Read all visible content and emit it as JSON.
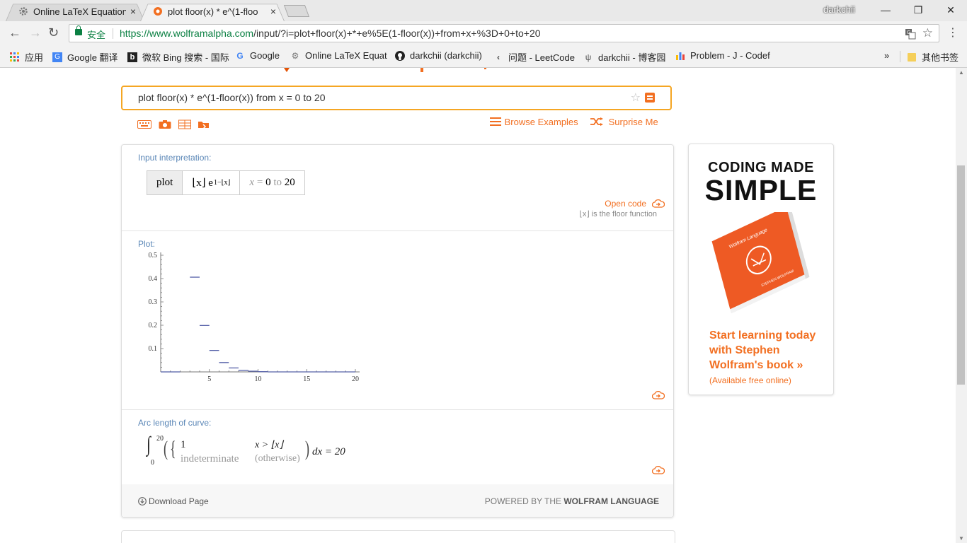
{
  "browser": {
    "tabs": [
      {
        "title": "Online LaTeX Equation",
        "close": "×",
        "active": false
      },
      {
        "title": "plot floor(x) * e^(1-floo",
        "close": "×",
        "active": true
      }
    ],
    "profile": "darkchii",
    "window_controls": {
      "minimize": "—",
      "maximize": "❐",
      "close": "✕"
    },
    "secure_label": "安全",
    "url_scheme_host": "https://www.wolframalpha.com",
    "url_path": "/input/?i=plot+floor(x)+*+e%5E(1-floor(x))+from+x+%3D+0+to+20",
    "bookmarks": [
      {
        "icon": "apps-grid-icon",
        "label": "应用"
      },
      {
        "icon": "google-translate-icon",
        "label": "Google 翻译"
      },
      {
        "icon": "bing-icon",
        "label": "微软 Bing 搜索 - 国际"
      },
      {
        "icon": "google-icon",
        "label": "Google"
      },
      {
        "icon": "gear-icon",
        "label": "Online LaTeX Equat"
      },
      {
        "icon": "github-icon",
        "label": "darkchii (darkchii)"
      },
      {
        "icon": "leetcode-icon",
        "label": "问题 - LeetCode"
      },
      {
        "icon": "cnblogs-icon",
        "label": "darkchii - 博客园"
      },
      {
        "icon": "codeforces-icon",
        "label": "Problem - J - Codef"
      }
    ],
    "bookmarks_overflow": "»",
    "other_bookmarks": "其他书签"
  },
  "search": {
    "query": "plot floor(x) * e^(1-floor(x)) from x = 0 to 20",
    "star": "☆"
  },
  "links": {
    "browse_examples": "Browse Examples",
    "surprise_me": "Surprise Me"
  },
  "pods": {
    "input_interpretation": {
      "title": "Input interpretation:",
      "cell_plot": "plot",
      "cell_func": "⌊x⌋ e",
      "cell_func_exp": "1−⌊x⌋",
      "cell_range_var": "x",
      "cell_range_eq": " = ",
      "cell_range_from": "0",
      "cell_range_to_word": " to ",
      "cell_range_to": "20",
      "open_code": "Open code",
      "note": "⌊x⌋ is the floor function"
    },
    "plot": {
      "title": "Plot:"
    },
    "arc_length": {
      "title": "Arc length of curve:",
      "lower": "0",
      "upper": "20",
      "case1_value": "1",
      "case1_cond": "x > ⌊x⌋",
      "case2_value": "indeterminate",
      "case2_cond": "(otherwise)",
      "tail": "dx = 20"
    }
  },
  "footer": {
    "download": "Download Page",
    "powered_prefix": "POWERED BY THE ",
    "powered_brand": "WOLFRAM LANGUAGE"
  },
  "ad": {
    "headline1": "CODING MADE",
    "headline2": "SIMPLE",
    "book_text": "AN ELEMENTARY INTRODUCTION TO THE Wolfram Language",
    "book_author": "STEPHEN WOLFRAM",
    "cta": "Start learning today with Stephen Wolfram's book »",
    "note": "(Available free online)"
  },
  "colors": {
    "accent_orange": "#f26f21",
    "search_border": "#f5a623",
    "pod_title_blue": "#5b87b7",
    "plot_line": "#5560a8"
  },
  "chart_data": {
    "type": "line",
    "title": "",
    "xlabel": "",
    "ylabel": "",
    "xlim": [
      0,
      20
    ],
    "ylim": [
      0,
      0.5
    ],
    "x_ticks": [
      5,
      10,
      15,
      20
    ],
    "y_ticks": [
      0.1,
      0.2,
      0.3,
      0.4,
      0.5
    ],
    "series": [
      {
        "style": "step",
        "segments": [
          {
            "x0": 0,
            "x1": 1,
            "y": 0.0
          },
          {
            "x0": 1,
            "x1": 2,
            "y": 0.0
          },
          {
            "x0": 3,
            "x1": 4,
            "y": 0.406
          },
          {
            "x0": 4,
            "x1": 5,
            "y": 0.199
          },
          {
            "x0": 5,
            "x1": 6,
            "y": 0.092
          },
          {
            "x0": 6,
            "x1": 7,
            "y": 0.04
          },
          {
            "x0": 7,
            "x1": 8,
            "y": 0.017
          },
          {
            "x0": 8,
            "x1": 9,
            "y": 0.007
          },
          {
            "x0": 9,
            "x1": 10,
            "y": 0.003
          },
          {
            "x0": 10,
            "x1": 11,
            "y": 0.001
          },
          {
            "x0": 11,
            "x1": 20,
            "y": 0.0
          }
        ]
      }
    ]
  }
}
